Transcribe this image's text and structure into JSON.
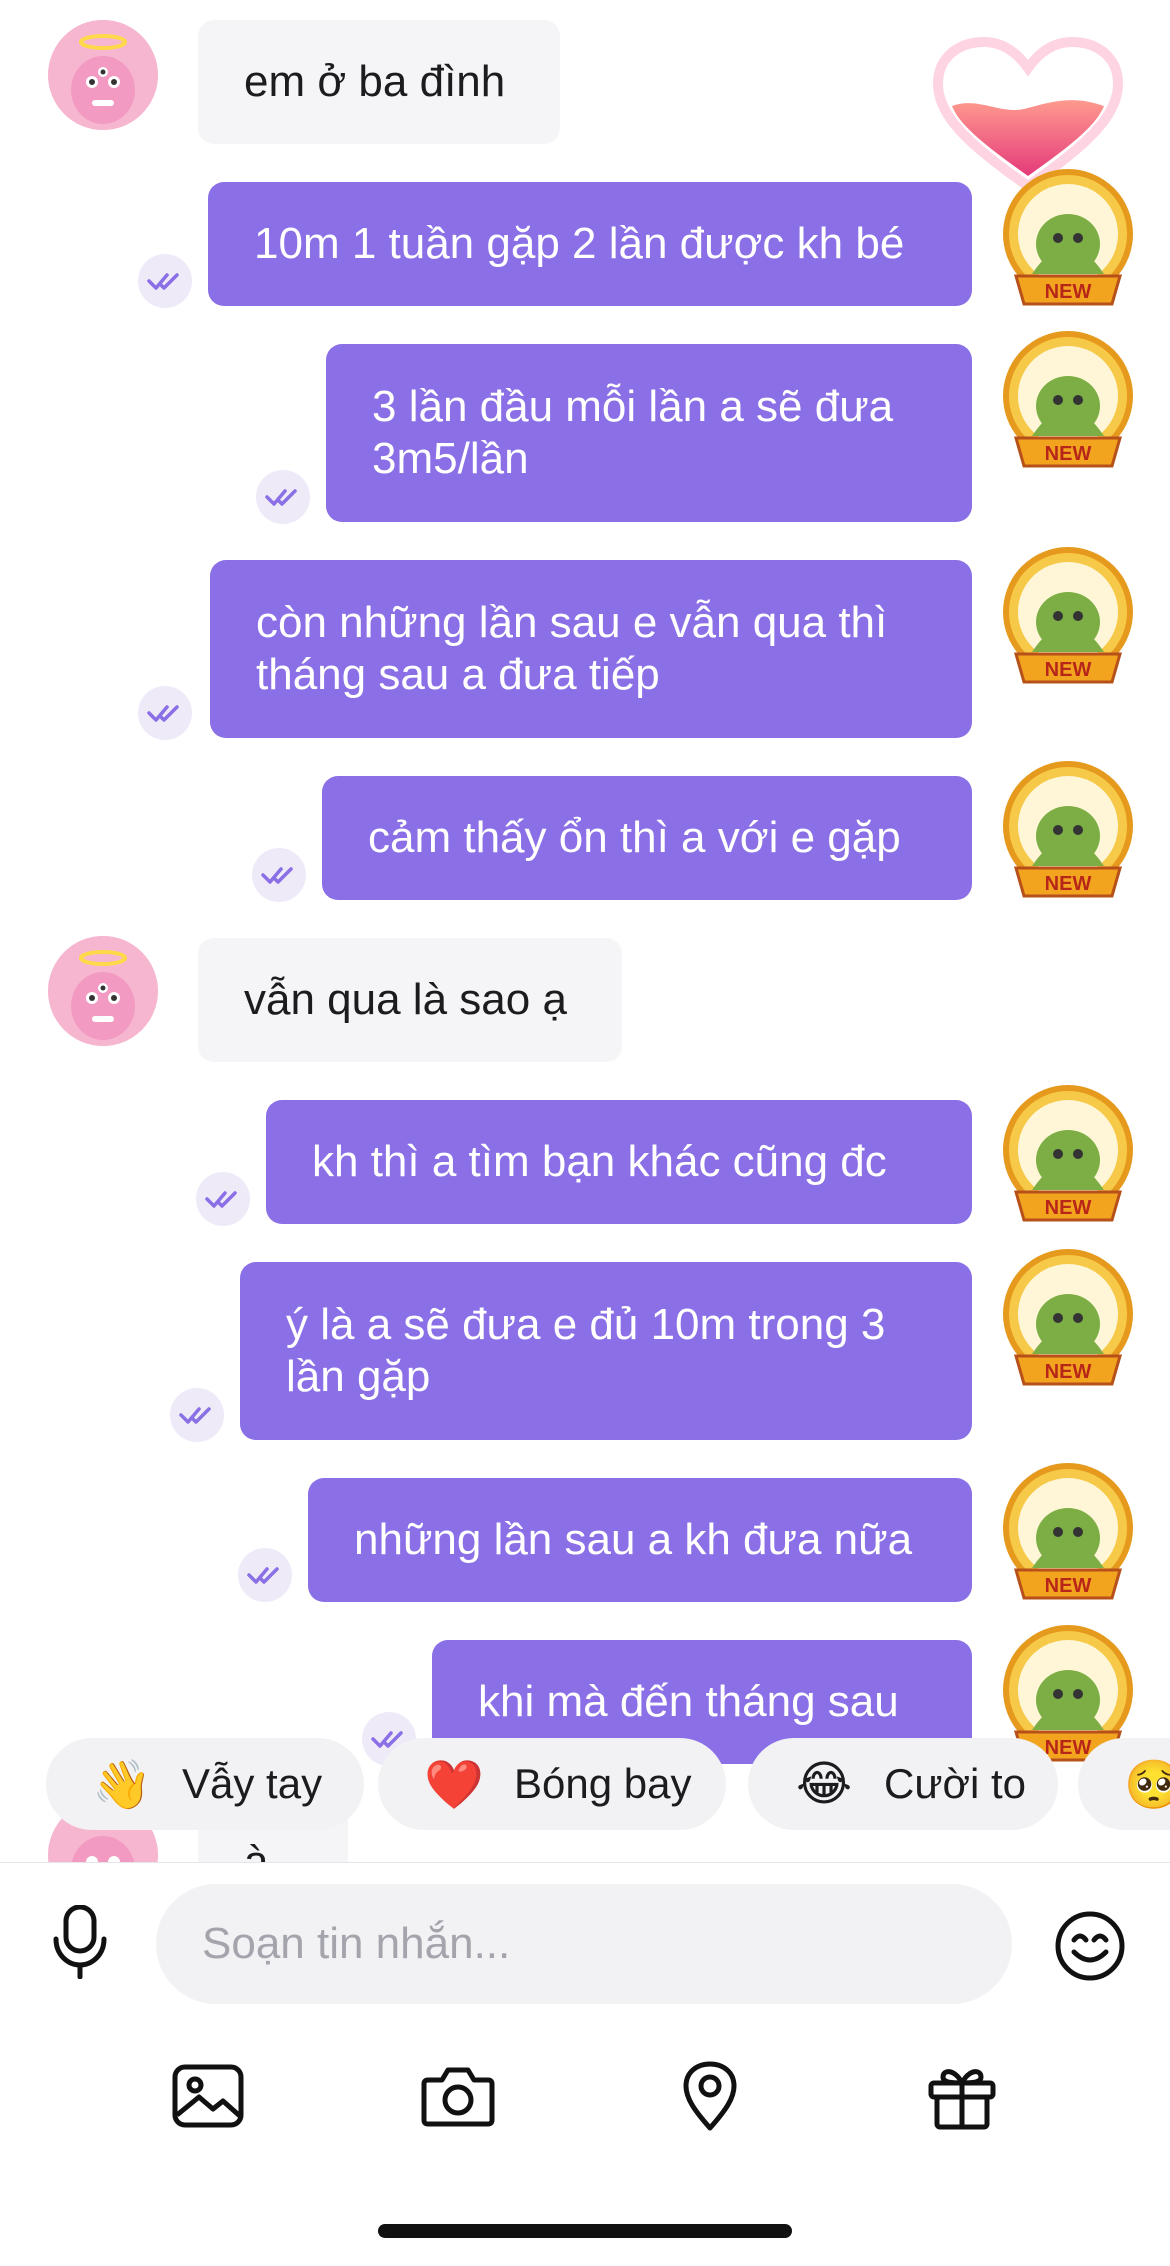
{
  "messages": [
    {
      "dir": "in",
      "text": "em ở ba đình",
      "avatar": "monster-avatar"
    },
    {
      "dir": "out",
      "text": "10m 1 tuần gặp 2 lần được kh bé",
      "read": true,
      "badge": "NEW"
    },
    {
      "dir": "out",
      "text": "3 lần đầu mỗi lần a sẽ đưa 3m5/lần",
      "read": true,
      "badge": "NEW"
    },
    {
      "dir": "out",
      "text": "còn những lần sau e vẫn qua thì tháng sau a đưa tiếp",
      "read": true,
      "badge": "NEW"
    },
    {
      "dir": "out",
      "text": "cảm thấy ổn thì a với e gặp",
      "read": true,
      "badge": "NEW"
    },
    {
      "dir": "in",
      "text": "vẫn qua là sao ạ",
      "avatar": "monster-avatar"
    },
    {
      "dir": "out",
      "text": "kh thì a tìm bạn khác cũng đc",
      "read": true,
      "badge": "NEW"
    },
    {
      "dir": "out",
      "text": "ý là a sẽ đưa e đủ 10m trong 3 lần gặp",
      "read": true,
      "badge": "NEW"
    },
    {
      "dir": "out",
      "text": "những lần sau a kh đưa nữa",
      "read": true,
      "badge": "NEW"
    },
    {
      "dir": "out",
      "text": "khi mà đến tháng sau",
      "read": true,
      "badge": "NEW"
    },
    {
      "dir": "in",
      "text": "à",
      "avatar": "monster-avatar"
    }
  ],
  "quick_reactions": [
    {
      "emoji": "👋",
      "label": "Vẫy tay"
    },
    {
      "emoji": "❤️",
      "label": "Bóng bay"
    },
    {
      "emoji": "😂",
      "label": "Cười to"
    },
    {
      "emoji": "🥺",
      "label": ""
    }
  ],
  "composer": {
    "placeholder": "Soạn tin nhắn...",
    "mic_icon": "microphone-icon",
    "emoji_icon": "smiley-icon"
  },
  "toolbar": {
    "icons": [
      "image-icon",
      "camera-icon",
      "location-pin-icon",
      "gift-icon"
    ]
  },
  "colors": {
    "outgoing_bubble": "#8a6fe6",
    "incoming_bubble": "#f5f5f7",
    "read_check": "#8a6fe6"
  }
}
